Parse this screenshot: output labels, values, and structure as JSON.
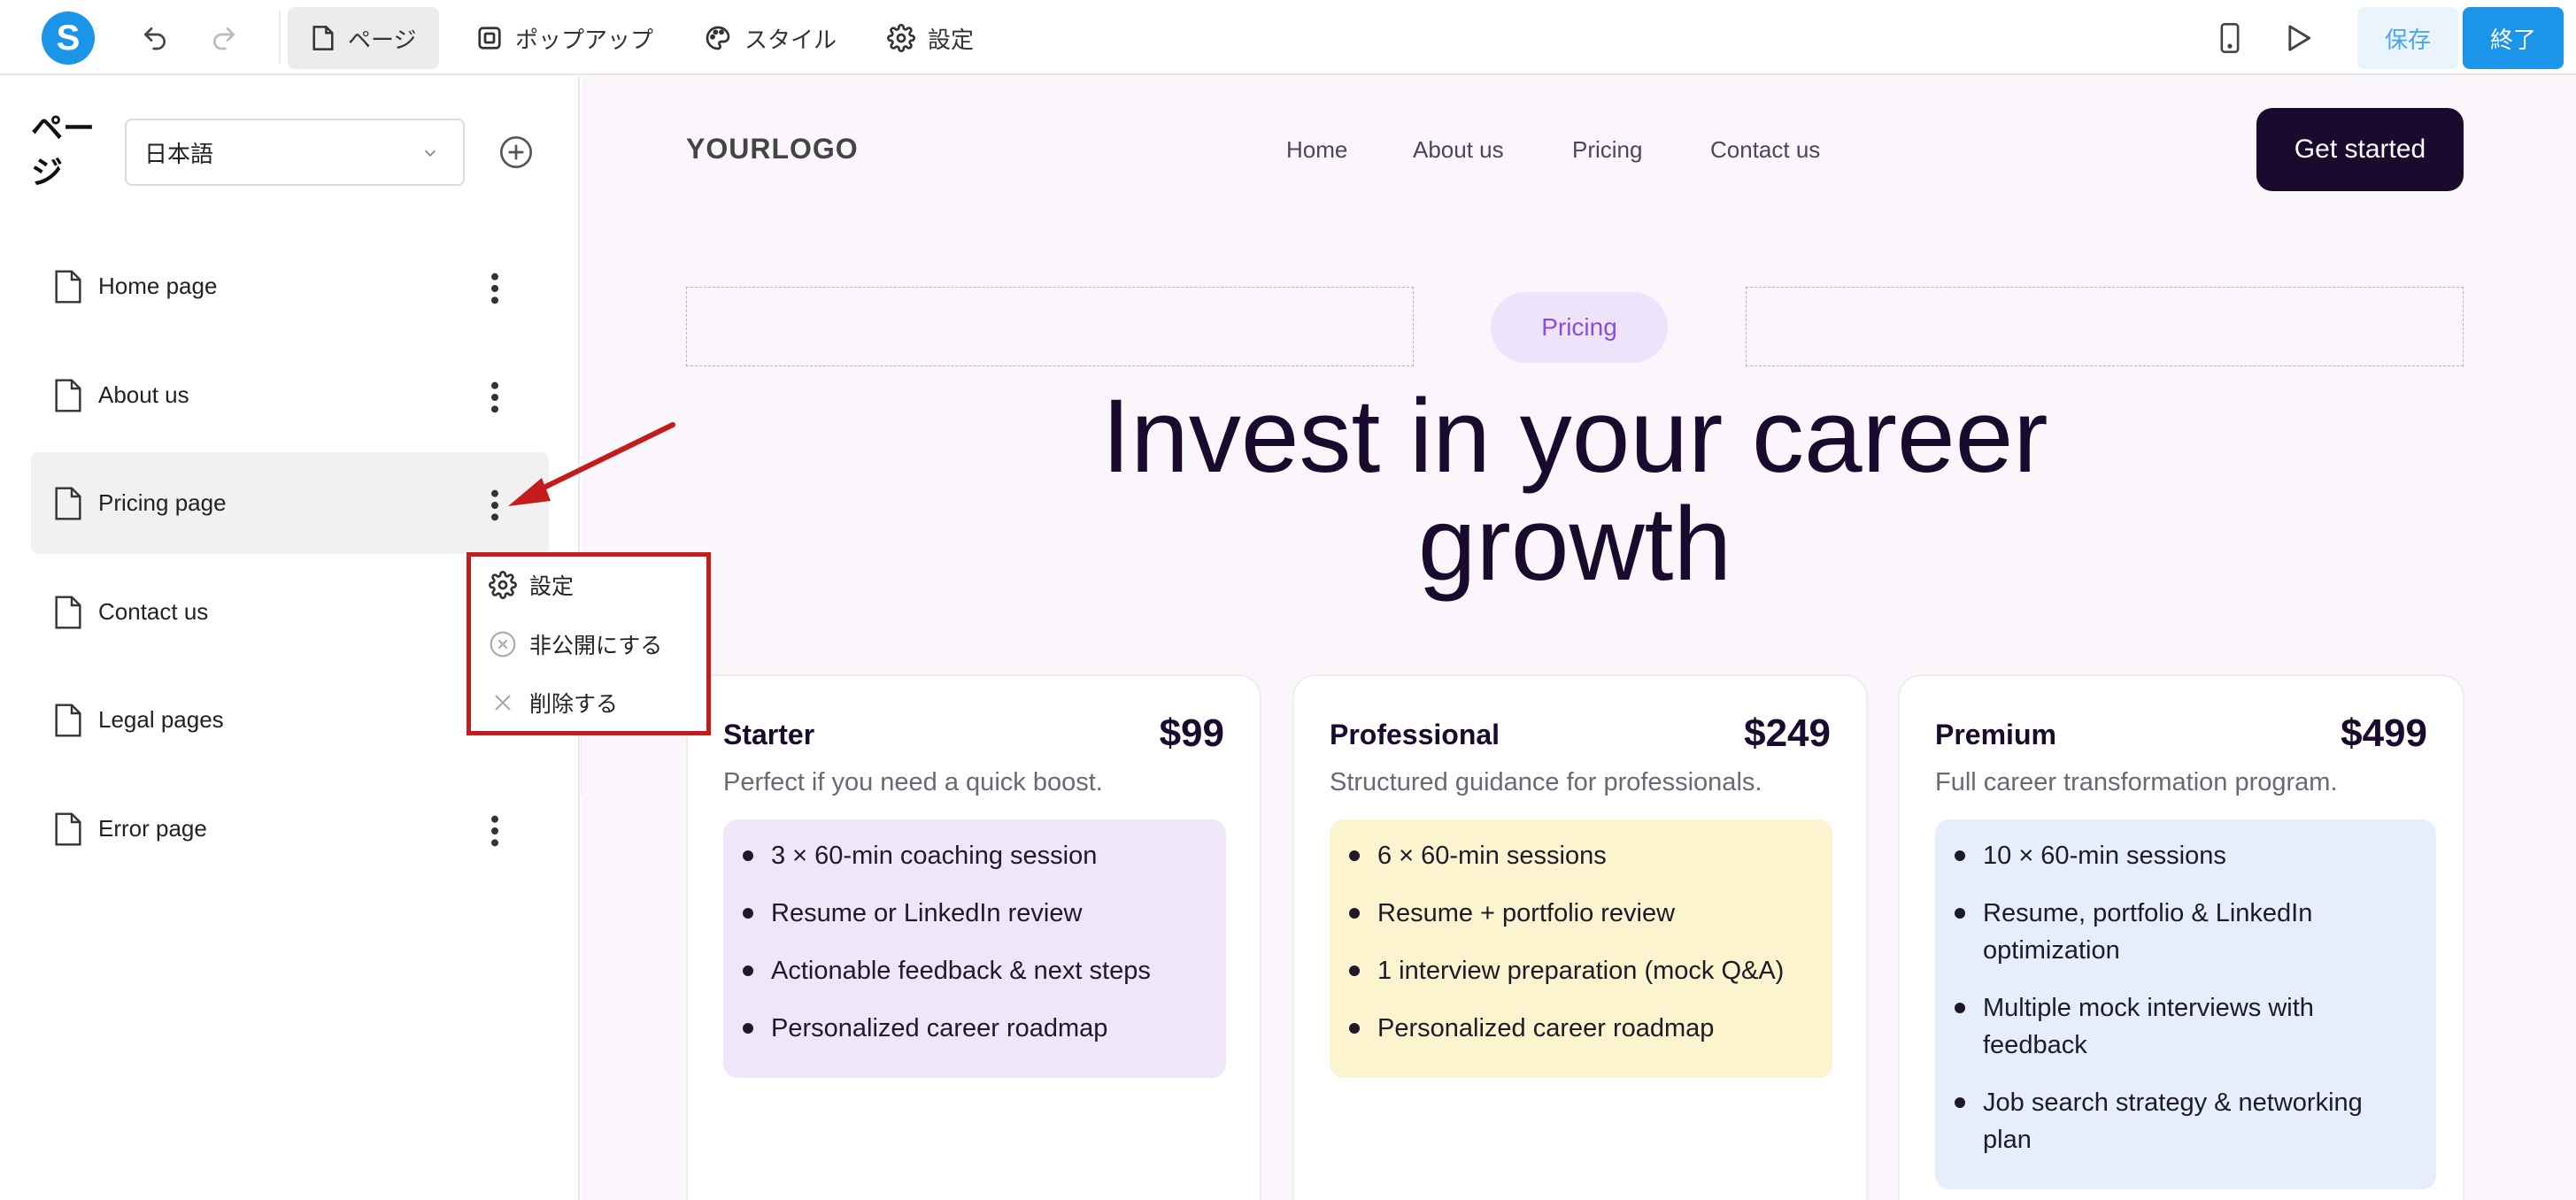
{
  "toolbar": {
    "logo_letter": "S",
    "tabs": [
      {
        "label": "ページ",
        "icon": "page-icon"
      },
      {
        "label": "ポップアップ",
        "icon": "popup-icon"
      },
      {
        "label": "スタイル",
        "icon": "palette-icon"
      },
      {
        "label": "設定",
        "icon": "gear-icon"
      }
    ],
    "save_label": "保存",
    "exit_label": "終了"
  },
  "sidebar": {
    "title": "ページ",
    "language": "日本語",
    "pages": [
      {
        "label": "Home page"
      },
      {
        "label": "About us"
      },
      {
        "label": "Pricing page"
      },
      {
        "label": "Contact us"
      },
      {
        "label": "Legal pages"
      },
      {
        "label": "Error page"
      }
    ],
    "context_menu": [
      {
        "label": "設定",
        "icon": "gear-icon"
      },
      {
        "label": "非公開にする",
        "icon": "unpublish-icon"
      },
      {
        "label": "削除する",
        "icon": "close-icon"
      }
    ]
  },
  "site": {
    "logo": "YOURLOGO",
    "nav": [
      "Home",
      "About us",
      "Pricing",
      "Contact us"
    ],
    "cta": "Get started",
    "badge": "Pricing",
    "headline_line1": "Invest in your career",
    "headline_line2": "growth",
    "plans": [
      {
        "name": "Starter",
        "price": "$99",
        "desc": "Perfect if you need a quick boost.",
        "color": "#efe6fc",
        "features": [
          "3 × 60-min coaching session",
          "Resume or LinkedIn review",
          "Actionable feedback & next steps",
          "Personalized career roadmap"
        ]
      },
      {
        "name": "Professional",
        "price": "$249",
        "desc": "Structured guidance for professionals.",
        "color": "#fbf4cf",
        "features": [
          "6 × 60-min sessions",
          "Resume + portfolio review",
          "1 interview preparation (mock Q&A)",
          "Personalized career roadmap"
        ]
      },
      {
        "name": "Premium",
        "price": "$499",
        "desc": "Full career transformation program.",
        "color": "#e6eefb",
        "features": [
          "10 × 60-min sessions",
          "Resume, portfolio & LinkedIn optimization",
          "Multiple mock interviews with feedback",
          "Job search strategy & networking plan"
        ]
      }
    ]
  },
  "colors": {
    "accent": "#1a95e8",
    "annotation": "#c41b1b",
    "site_dark": "#1a0a2e",
    "badge": "#8a4fd8"
  }
}
